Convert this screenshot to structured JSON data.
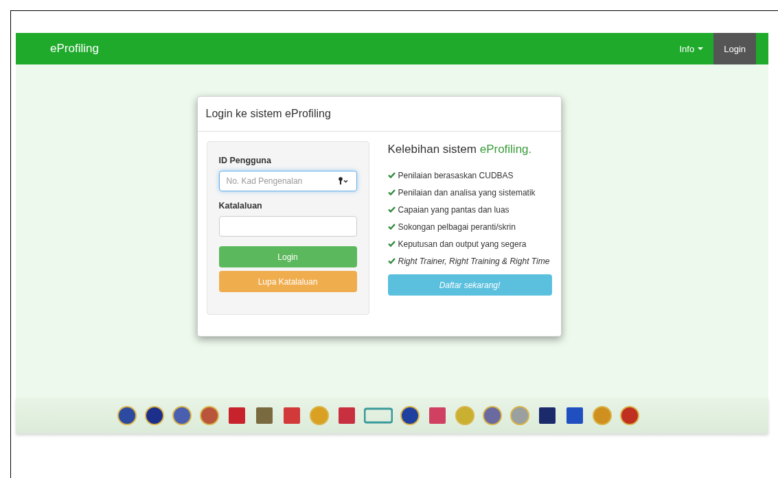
{
  "navbar": {
    "brand": "eProfiling",
    "menu": [
      {
        "label": "Info",
        "dropdown": true,
        "selected": false
      },
      {
        "label": "Login",
        "dropdown": false,
        "selected": true
      }
    ]
  },
  "login_card": {
    "title": "Login ke sistem eProfiling",
    "form": {
      "fields": [
        {
          "label": "ID Pengguna",
          "placeholder": "No. Kad Pengenalan",
          "focused": true,
          "key_icon": true
        },
        {
          "label": "Katalaluan",
          "focused": false,
          "key_icon": false
        }
      ],
      "buttons": [
        {
          "label": "Login",
          "kind": "success"
        },
        {
          "label": "Lupa Katalaluan",
          "kind": "warning"
        }
      ]
    },
    "benefits": {
      "heading": "Kelebihan sistem ",
      "heading_brand": "eProfiling.",
      "items": [
        {
          "text": "Penilaian berasaskan CUDBAS",
          "italic": false
        },
        {
          "text": "Penilaian dan analisa yang sistematik",
          "italic": false
        },
        {
          "text": "Capaian yang pantas dan luas",
          "italic": false
        },
        {
          "text": "Sokongan pelbagai peranti/skrin",
          "italic": false
        },
        {
          "text": "Keputusan dan output yang segera",
          "italic": false
        },
        {
          "text": "Right Trainer, Right Training & Right Time",
          "italic": true
        }
      ],
      "register_button": "Daftar sekarang!"
    }
  },
  "footer_logos": [
    {
      "kind": "round"
    },
    {
      "kind": "round"
    },
    {
      "kind": "round"
    },
    {
      "kind": "round"
    },
    {
      "kind": "square"
    },
    {
      "kind": "square"
    },
    {
      "kind": "square"
    },
    {
      "kind": "round"
    },
    {
      "kind": "square"
    },
    {
      "kind": "wide"
    },
    {
      "kind": "round"
    },
    {
      "kind": "square"
    },
    {
      "kind": "round"
    },
    {
      "kind": "round"
    },
    {
      "kind": "round"
    },
    {
      "kind": "square"
    },
    {
      "kind": "square"
    },
    {
      "kind": "round"
    },
    {
      "kind": "round"
    }
  ]
}
